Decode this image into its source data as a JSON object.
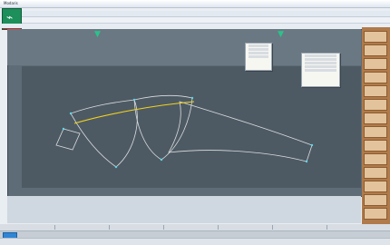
{
  "window": {
    "title": "Modaris"
  }
}
